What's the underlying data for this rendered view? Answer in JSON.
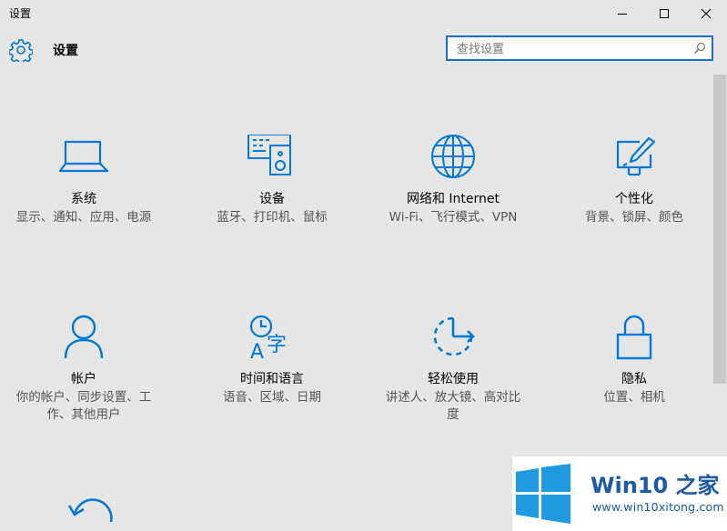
{
  "window": {
    "title": "设置"
  },
  "header": {
    "title": "设置",
    "search_placeholder": "查找设置"
  },
  "tiles": [
    {
      "name": "系统",
      "desc": "显示、通知、应用、电源",
      "icon": "laptop-icon"
    },
    {
      "name": "设备",
      "desc": "蓝牙、打印机、鼠标",
      "icon": "devices-icon"
    },
    {
      "name": "网络和 Internet",
      "desc": "Wi-Fi、飞行模式、VPN",
      "icon": "globe-icon"
    },
    {
      "name": "个性化",
      "desc": "背景、锁屏、颜色",
      "icon": "paint-icon"
    },
    {
      "name": "帐户",
      "desc": "你的帐户、同步设置、工作、其他用户",
      "icon": "person-icon"
    },
    {
      "name": "时间和语言",
      "desc": "语音、区域、日期",
      "icon": "clock-language-icon"
    },
    {
      "name": "轻松使用",
      "desc": "讲述人、放大镜、高对比度",
      "icon": "ease-of-access-icon"
    },
    {
      "name": "隐私",
      "desc": "位置、相机",
      "icon": "lock-icon"
    }
  ],
  "watermark": {
    "title": "Win10 之家",
    "url": "www.win10xitong.com"
  },
  "colors": {
    "accent": "#0078d7",
    "background": "#e6e6e6"
  }
}
